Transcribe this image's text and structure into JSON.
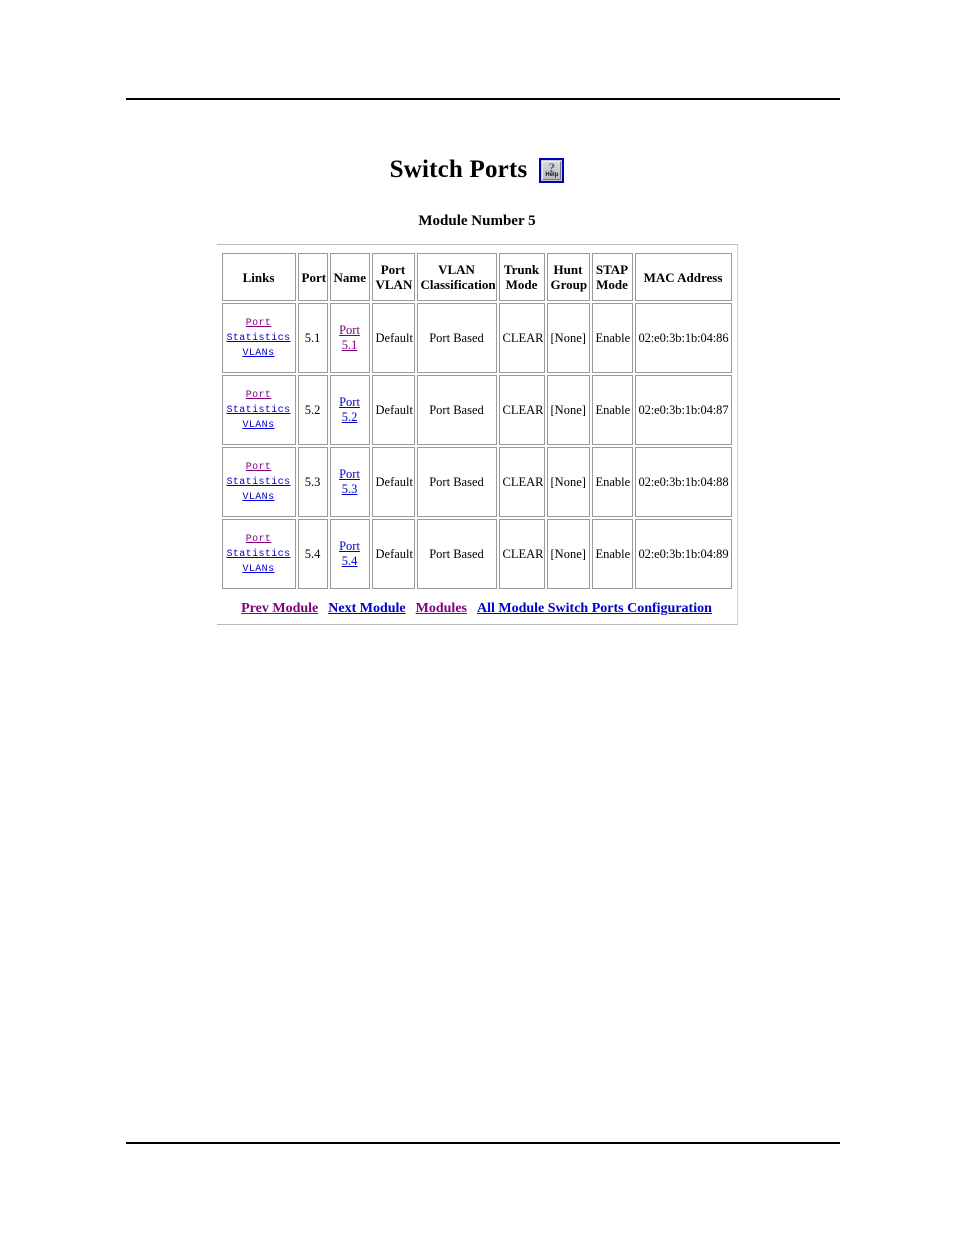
{
  "page": {
    "title": "Switch Ports",
    "module_label": "Module Number 5",
    "help_icon": {
      "name": "help-icon",
      "glyph": "?",
      "label": "Help",
      "border_color": "#0000bb"
    }
  },
  "colors": {
    "visited_link": "#800080",
    "new_link": "#0000cc",
    "table_border": "#9a9a9a",
    "rule": "#000000"
  },
  "table": {
    "headers": [
      "Links",
      "Port",
      "Name",
      "Port VLAN",
      "VLAN Classification",
      "Trunk Mode",
      "Hunt Group",
      "STAP Mode",
      "MAC Address"
    ],
    "header_lines": [
      [
        "Links"
      ],
      [
        "Port"
      ],
      [
        "Name"
      ],
      [
        "Port",
        "VLAN"
      ],
      [
        "VLAN",
        "Classification"
      ],
      [
        "Trunk",
        "Mode"
      ],
      [
        "Hunt",
        "Group"
      ],
      [
        "STAP",
        "Mode"
      ],
      [
        "MAC Address"
      ]
    ],
    "rows": [
      {
        "links": [
          {
            "label": "Port",
            "state": "visited"
          },
          {
            "label": "Statistics",
            "state": "new"
          },
          {
            "label": "VLANs",
            "state": "new"
          }
        ],
        "port": "5.1",
        "name_link": {
          "line1": "Port",
          "line2": "5.1",
          "state": "visited"
        },
        "port_vlan": "Default",
        "vlan_classification": "Port Based",
        "trunk_mode": "CLEAR",
        "hunt_group": "[None]",
        "stap_mode": "Enable",
        "mac_address": "02:e0:3b:1b:04:86"
      },
      {
        "links": [
          {
            "label": "Port",
            "state": "visited"
          },
          {
            "label": "Statistics",
            "state": "new"
          },
          {
            "label": "VLANs",
            "state": "new"
          }
        ],
        "port": "5.2",
        "name_link": {
          "line1": "Port",
          "line2": "5.2",
          "state": "new"
        },
        "port_vlan": "Default",
        "vlan_classification": "Port Based",
        "trunk_mode": "CLEAR",
        "hunt_group": "[None]",
        "stap_mode": "Enable",
        "mac_address": "02:e0:3b:1b:04:87"
      },
      {
        "links": [
          {
            "label": "Port",
            "state": "visited"
          },
          {
            "label": "Statistics",
            "state": "new"
          },
          {
            "label": "VLANs",
            "state": "new"
          }
        ],
        "port": "5.3",
        "name_link": {
          "line1": "Port",
          "line2": "5.3",
          "state": "new"
        },
        "port_vlan": "Default",
        "vlan_classification": "Port Based",
        "trunk_mode": "CLEAR",
        "hunt_group": "[None]",
        "stap_mode": "Enable",
        "mac_address": "02:e0:3b:1b:04:88"
      },
      {
        "links": [
          {
            "label": "Port",
            "state": "visited"
          },
          {
            "label": "Statistics",
            "state": "new"
          },
          {
            "label": "VLANs",
            "state": "new"
          }
        ],
        "port": "5.4",
        "name_link": {
          "line1": "Port",
          "line2": "5.4",
          "state": "new"
        },
        "port_vlan": "Default",
        "vlan_classification": "Port Based",
        "trunk_mode": "CLEAR",
        "hunt_group": "[None]",
        "stap_mode": "Enable",
        "mac_address": "02:e0:3b:1b:04:89"
      }
    ]
  },
  "nav": {
    "items": [
      {
        "label": "Prev Module",
        "state": "visited"
      },
      {
        "label": "Next Module",
        "state": "new"
      },
      {
        "label": "Modules",
        "state": "visited"
      },
      {
        "label": "All Module Switch Ports Configuration",
        "state": "new"
      }
    ]
  }
}
